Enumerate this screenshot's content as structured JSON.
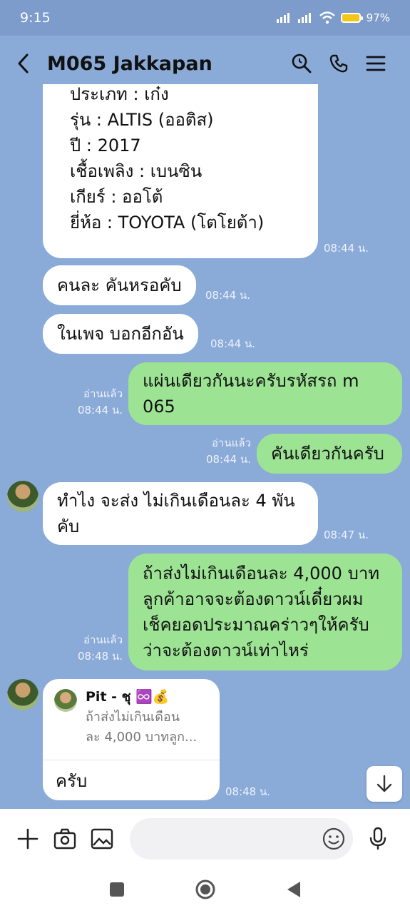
{
  "status_bar": {
    "time": "9:15",
    "battery": "97%"
  },
  "header": {
    "title": "M065 Jakkapan"
  },
  "messages": {
    "m1": {
      "lines": [
        "ประเภท : เก๋ง",
        "รุ่น : ALTIS (ออติส)",
        "ปี : 2017",
        "เชื้อเพลิง : เบนซิน",
        "เกียร์ : ออโต้",
        "ยี่ห้อ : TOYOTA (โตโยต้า)"
      ],
      "time": "08:44 น."
    },
    "m2": {
      "text": "คนละ คันหรอคับ",
      "time": "08:44 น."
    },
    "m3": {
      "text": "ในเพจ บอกอีกอัน",
      "time": "08:44 น."
    },
    "m4": {
      "lines": [
        "แผ่นเดียวกันนะครับรหัสรถ m",
        "065"
      ],
      "read": "อ่านแล้ว",
      "time": "08:44 น."
    },
    "m5": {
      "text": "คันเดียวกันครับ",
      "read": "อ่านแล้ว",
      "time": "08:44 น."
    },
    "m6": {
      "lines": [
        "ทำไง จะส่ง ไม่เกินเดือนละ 4 พัน",
        "คับ"
      ],
      "time": "08:47 น."
    },
    "m7": {
      "lines": [
        "ถ้าส่งไม่เกินเดือนละ 4,000 บาท",
        "ลูกค้าอาจจะต้องดาวน์เดี๋ยวผม",
        "เช็คยอดประมาณคร่าวๆให้ครับ",
        "ว่าจะต้องดาวน์เท่าไหร่"
      ],
      "read": "อ่านแล้ว",
      "time": "08:48 น."
    },
    "m8": {
      "quote_author": "Pit - ชุ ♾️💰",
      "quote_lines": [
        "ถ้าส่งไม่เกินเดือน",
        "ละ 4,000 บาทลูก..."
      ],
      "text": "ครับ",
      "time": "08:48 น."
    }
  },
  "input": {
    "placeholder": ""
  },
  "colors": {
    "chat_bg": "#8aaad8",
    "outgoing": "#9ce494",
    "incoming": "#ffffff"
  }
}
